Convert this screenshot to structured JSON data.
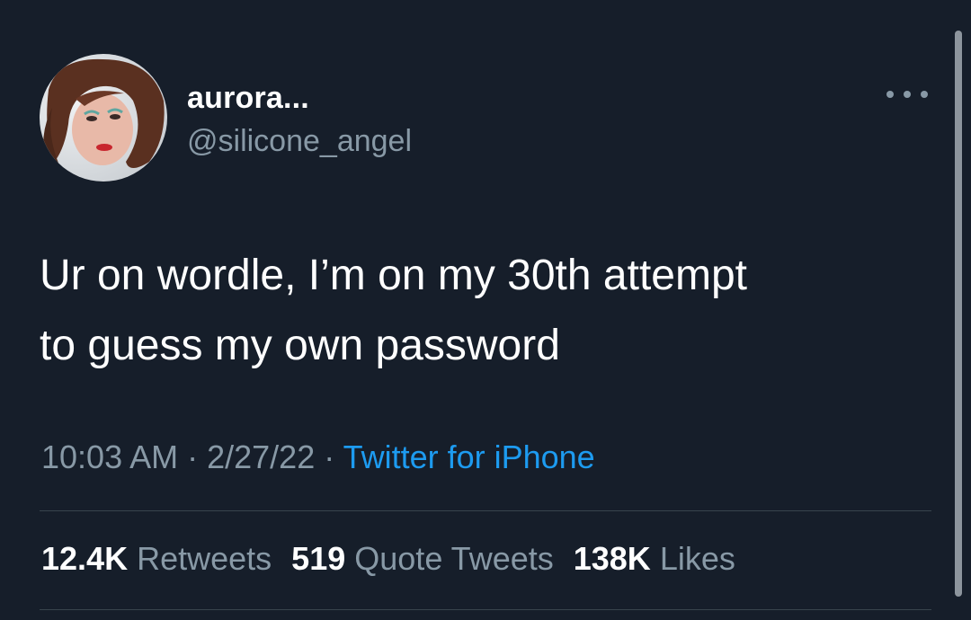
{
  "author": {
    "display_name": "aurora...",
    "handle": "@silicone_angel",
    "avatar_icon": "user-avatar-photo"
  },
  "menu": {
    "icon": "more-options-icon"
  },
  "tweet": {
    "text_line1": "Ur on wordle, I’m on my 30th attempt",
    "text_line2": "to guess my own password"
  },
  "meta": {
    "time": "10:03 AM",
    "separator1": " · ",
    "date": "2/27/22",
    "separator2": " · ",
    "source": "Twitter for iPhone"
  },
  "stats": {
    "retweets_count": "12.4K",
    "retweets_label": "Retweets",
    "quotes_count": "519",
    "quotes_label": "Quote Tweets",
    "likes_count": "138K",
    "likes_label": "Likes"
  },
  "colors": {
    "background": "#161e2a",
    "primary_text": "#ffffff",
    "secondary_text": "#8899a6",
    "link": "#1d9bf0",
    "divider": "#38444d"
  }
}
